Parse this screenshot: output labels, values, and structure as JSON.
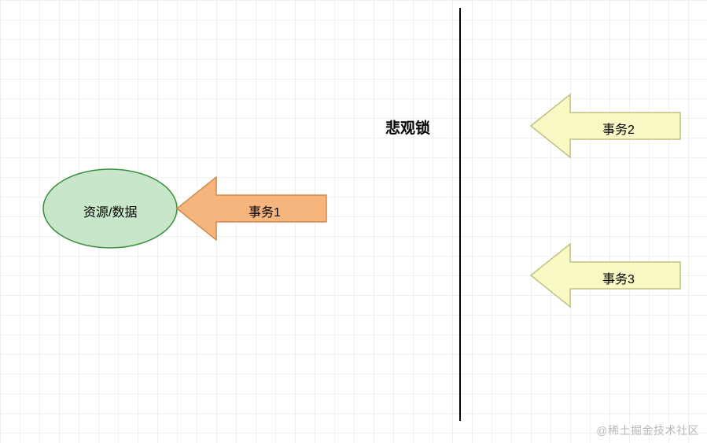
{
  "diagram": {
    "title": "悲观锁",
    "resource_label": "资源/数据",
    "arrow1_label": "事务1",
    "arrow2_label": "事务2",
    "arrow3_label": "事务3",
    "watermark": "@稀土掘金技术社区",
    "colors": {
      "ellipse_fill": "#c8e6c9",
      "ellipse_stroke": "#388e3c",
      "arrow1_fill": "#f5b57d",
      "arrow1_stroke": "#d08a4b",
      "arrow_right_fill": "#f9f9c5",
      "arrow_right_stroke": "#c0c080",
      "divider_stroke": "#000000"
    }
  }
}
